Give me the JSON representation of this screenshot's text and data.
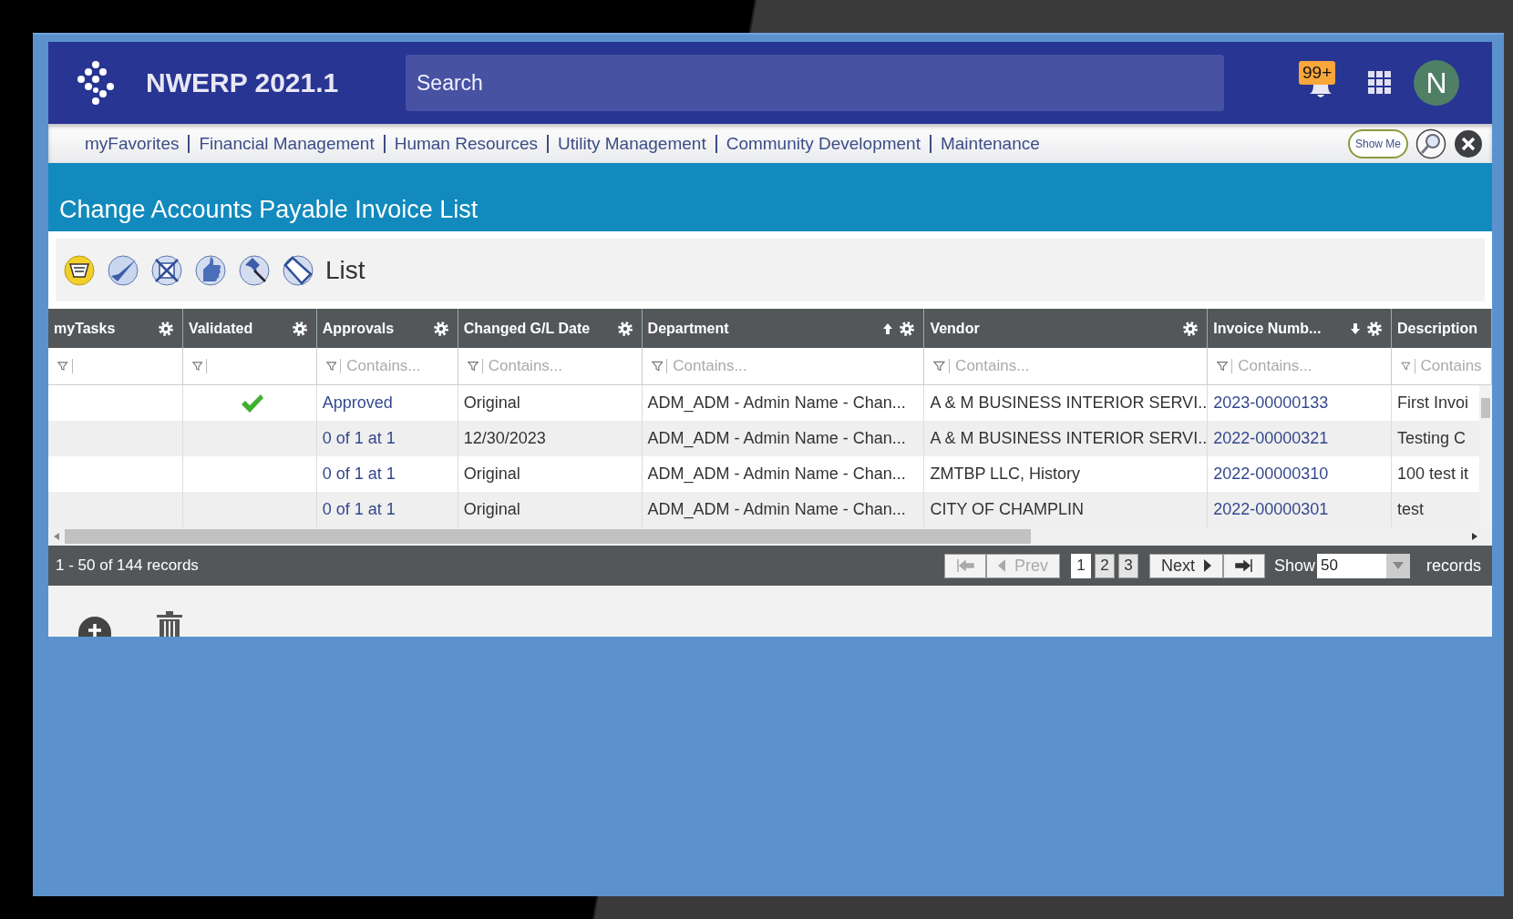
{
  "app": {
    "title": "NWERP 2021.1",
    "search": {
      "placeholder": "Search"
    },
    "notifications": "99+",
    "avatar": "N"
  },
  "nav": {
    "links": [
      "myFavorites",
      "Financial Management",
      "Human Resources",
      "Utility Management",
      "Community Development",
      "Maintenance"
    ],
    "show_me": "Show Me"
  },
  "page": {
    "title": "Change Accounts Payable Invoice List",
    "toolbar_label": "List"
  },
  "table": {
    "columns": [
      {
        "label": "myTasks",
        "sorted_ascending": false,
        "sorted_descending": false
      },
      {
        "label": "Validated",
        "sorted_ascending": false,
        "sorted_descending": false
      },
      {
        "label": "Approvals",
        "sorted_ascending": false,
        "sorted_descending": false,
        "placeholder": "Contains..."
      },
      {
        "label": "Changed G/L Date",
        "sorted_ascending": false,
        "sorted_descending": false,
        "placeholder": "Contains..."
      },
      {
        "label": "Department",
        "sorted_ascending": true,
        "sorted_descending": false,
        "placeholder": "Contains..."
      },
      {
        "label": "Vendor",
        "sorted_ascending": false,
        "sorted_descending": false,
        "placeholder": "Contains..."
      },
      {
        "label": "Invoice Numb...",
        "sorted_ascending": false,
        "sorted_descending": true,
        "placeholder": "Contains..."
      },
      {
        "label": "Description",
        "sorted_ascending": false,
        "sorted_descending": false,
        "placeholder": "Contains"
      }
    ],
    "rows": [
      {
        "validated": true,
        "approvals": "Approved",
        "gl_date": "Original",
        "department": "ADM_ADM - Admin Name - Chan...",
        "vendor": "A & M BUSINESS INTERIOR SERVI...",
        "invoice": "2023-00000133",
        "description": "First Invoi"
      },
      {
        "validated": false,
        "approvals": "0 of 1 at 1",
        "gl_date": "12/30/2023",
        "department": "ADM_ADM - Admin Name - Chan...",
        "vendor": "A & M BUSINESS INTERIOR SERVI...",
        "invoice": "2022-00000321",
        "description": "Testing C"
      },
      {
        "validated": false,
        "approvals": "0 of 1 at 1",
        "gl_date": "Original",
        "department": "ADM_ADM - Admin Name - Chan...",
        "vendor": "ZMTBP LLC, History",
        "invoice": "2022-00000310",
        "description": "100 test it"
      },
      {
        "validated": false,
        "approvals": "0 of 1 at 1",
        "gl_date": "Original",
        "department": "ADM_ADM - Admin Name - Chan...",
        "vendor": "CITY OF CHAMPLIN",
        "invoice": "2022-00000301",
        "description": "test"
      }
    ]
  },
  "pager": {
    "summary": "1 - 50 of 144 records",
    "first_disabled": true,
    "prev": {
      "label": "Prev",
      "disabled": true
    },
    "pages": [
      {
        "label": "1",
        "selected": true
      },
      {
        "label": "2",
        "selected": false
      },
      {
        "label": "3",
        "selected": false
      }
    ],
    "next": {
      "label": "Next",
      "disabled": false
    },
    "last_disabled": false,
    "show_label": "Show",
    "page_size": "50",
    "records_label": "records"
  }
}
